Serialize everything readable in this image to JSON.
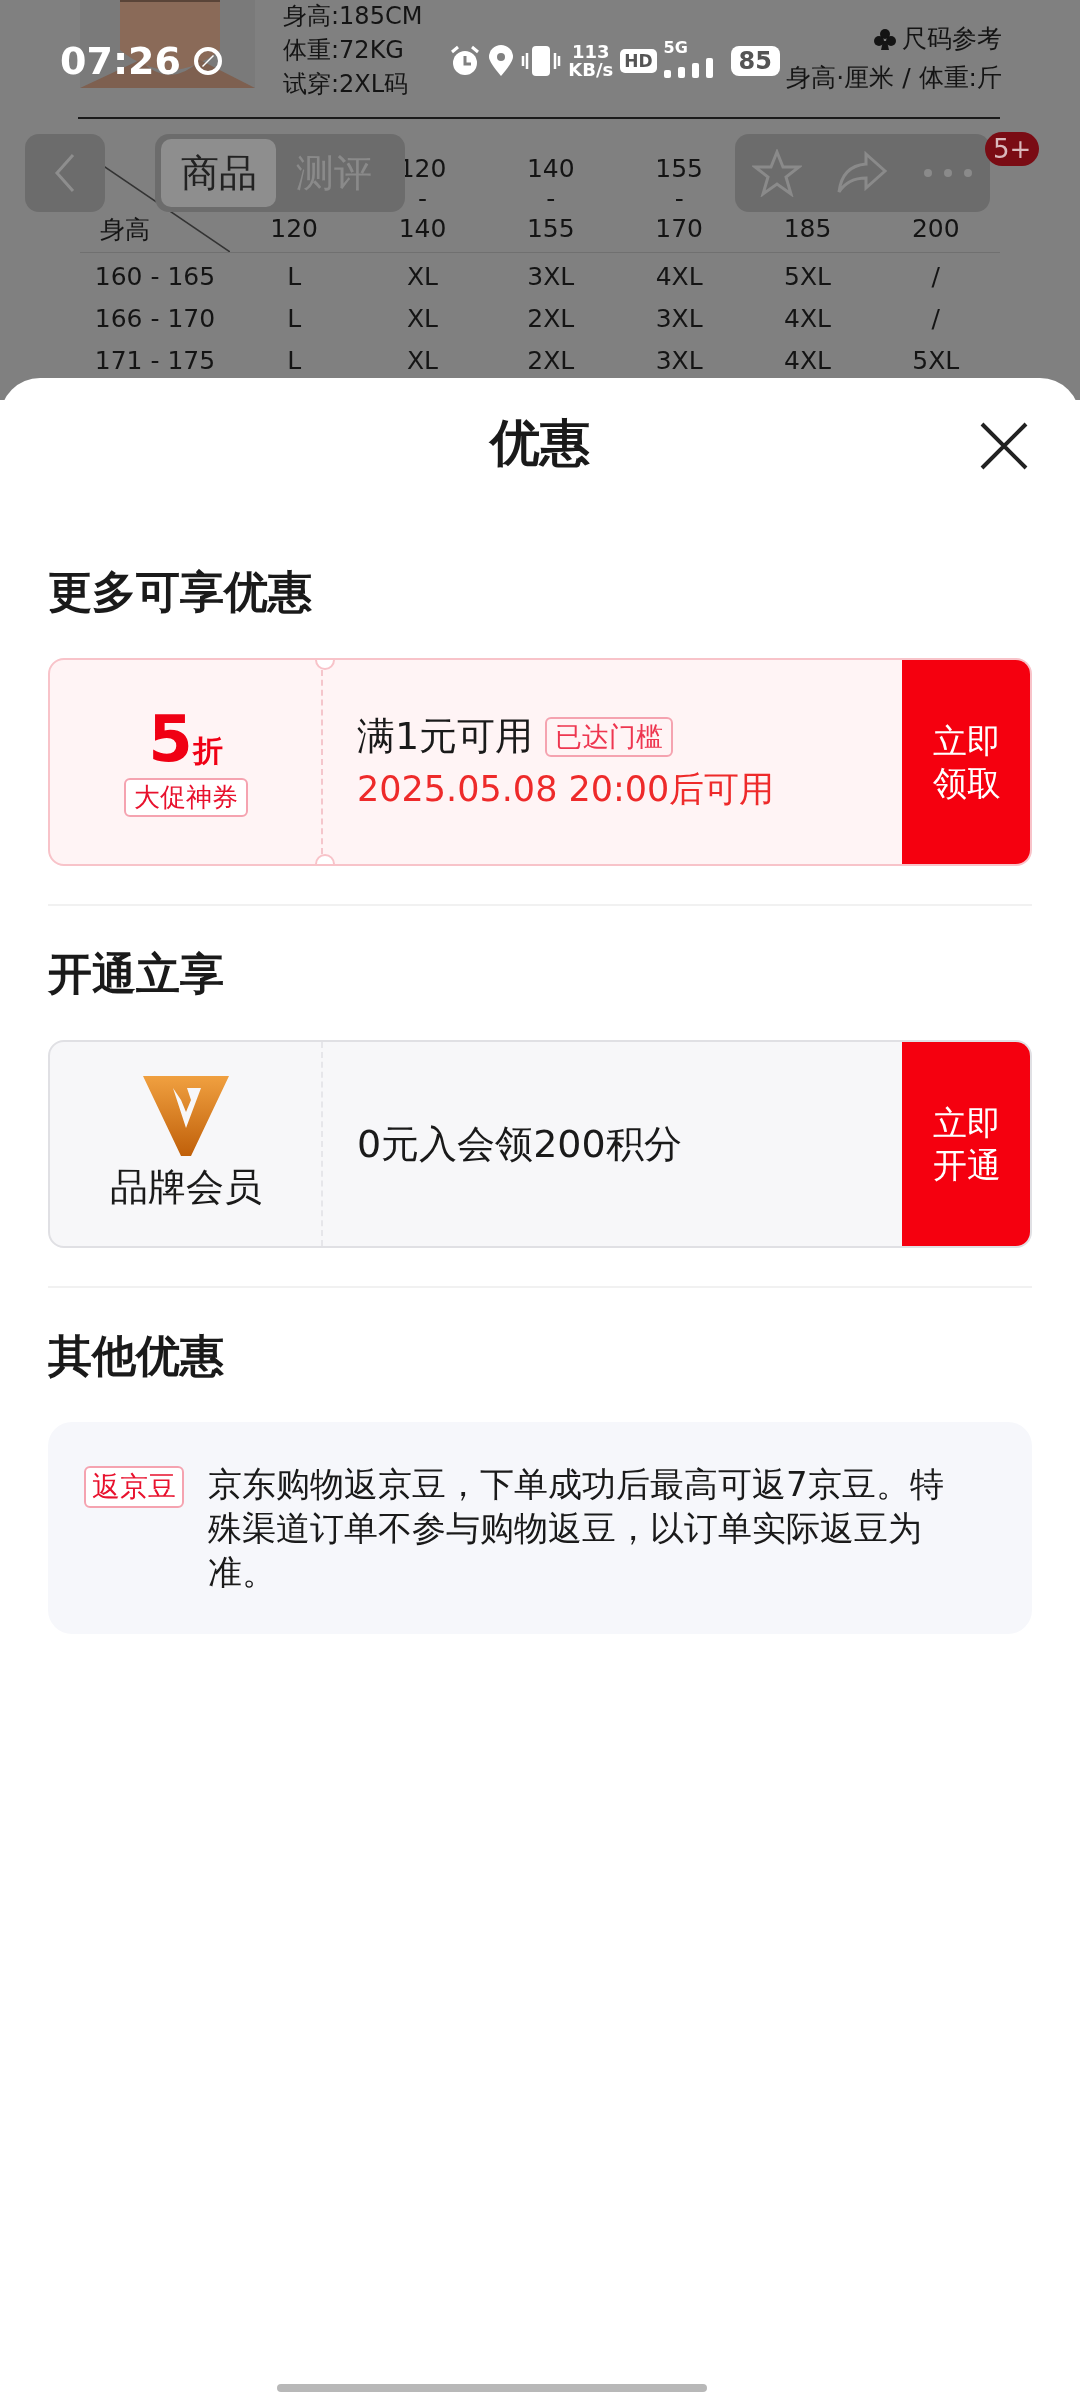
{
  "background_page": {
    "product_info": [
      "身高:185CM",
      "体重:72KG",
      "试穿:2XL码"
    ],
    "size_reference": {
      "title": "尺码参考",
      "units": "身高·厘米 / 体重:斤"
    },
    "size_table": {
      "corner_bottom": "身高",
      "columns": [
        {
          "to": "120"
        },
        {
          "from": "120",
          "sep": "-",
          "to": "140"
        },
        {
          "from": "140",
          "sep": "-",
          "to": "155"
        },
        {
          "from": "155",
          "sep": "-",
          "to": "170"
        },
        {
          "to": "185"
        },
        {
          "to": "200"
        }
      ],
      "rows": [
        {
          "height": "160 - 165",
          "sizes": [
            "L",
            "XL",
            "3XL",
            "4XL",
            "5XL",
            "/"
          ]
        },
        {
          "height": "166 - 170",
          "sizes": [
            "L",
            "XL",
            "2XL",
            "3XL",
            "4XL",
            "/"
          ]
        },
        {
          "height": "171 - 175",
          "sizes": [
            "L",
            "XL",
            "2XL",
            "3XL",
            "4XL",
            "5XL"
          ]
        }
      ]
    }
  },
  "status_bar": {
    "time": "07:26",
    "network_speed": "113",
    "speed_unit": "KB/s",
    "hd": "HD",
    "network": "5G",
    "battery": "85"
  },
  "nav": {
    "tabs": [
      {
        "label": "商品",
        "selected": true
      },
      {
        "label": "测评",
        "selected": false
      }
    ],
    "badge": "5+"
  },
  "sheet": {
    "title": "优惠",
    "sections": [
      {
        "heading": "更多可享优惠",
        "card": {
          "kind": "coupon",
          "value": "5",
          "unit": "折",
          "tag": "大促神券",
          "condition": "满1元可用",
          "status_tag": "已达门槛",
          "valid_time": "2025.05.08 20:00后可用",
          "action": "立即领取"
        }
      },
      {
        "heading": "开通立享",
        "card": {
          "kind": "membership",
          "label": "品牌会员",
          "text": "0元入会领200积分",
          "action": "立即开通"
        }
      },
      {
        "heading": "其他优惠",
        "card": {
          "kind": "note",
          "tag": "返京豆",
          "text": "京东购物返京豆，下单成功后最高可返7京豆。特殊渠道订单不参与购物返豆，以订单实际返豆为准。"
        }
      }
    ]
  }
}
